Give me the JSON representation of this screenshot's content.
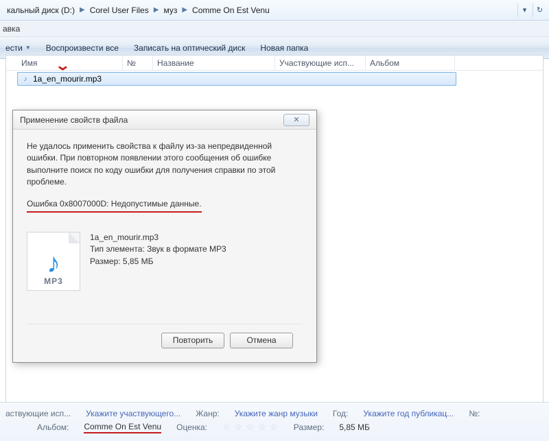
{
  "breadcrumb": {
    "items": [
      "кальный диск (D:)",
      "Corel User Files",
      "муз",
      "Comme On Est Venu"
    ]
  },
  "menubar": {
    "item": "авка"
  },
  "toolbar": {
    "organize": "ести",
    "playall": "Воспроизвести все",
    "burn": "Записать на оптический диск",
    "newfolder": "Новая папка"
  },
  "columns": {
    "name": "Имя",
    "num": "№",
    "title": "Название",
    "artist": "Участвующие исп...",
    "album": "Альбом"
  },
  "file": {
    "name": "1a_en_mourir.mp3"
  },
  "dialog": {
    "title": "Применение свойств файла",
    "message": "Не удалось применить свойства к файлу из-за непредвиденной ошибки. При повторном появлении этого сообщения об ошибке выполните поиск по коду ошибки для получения справки по этой проблеме.",
    "error": "Ошибка 0x8007000D: Недопустимые данные.",
    "filename": "1a_en_mourir.mp3",
    "filetype": "Тип элемента: Звук в формате MP3",
    "filesize": "Размер: 5,85 МБ",
    "icon_label": "MP3",
    "retry": "Повторить",
    "cancel": "Отмена"
  },
  "details": {
    "artist_label": "аствующие исп...",
    "artist_value": "Укажите участвующего...",
    "genre_label": "Жанр:",
    "genre_value": "Укажите жанр музыки",
    "year_label": "Год:",
    "year_value": "Укажите год публикац...",
    "numcol_label": "№:",
    "album_label": "Альбом:",
    "album_value": "Comme On Est Venu",
    "rating_label": "Оценка:",
    "size_label": "Размер:",
    "size_value": "5,85 МБ"
  }
}
